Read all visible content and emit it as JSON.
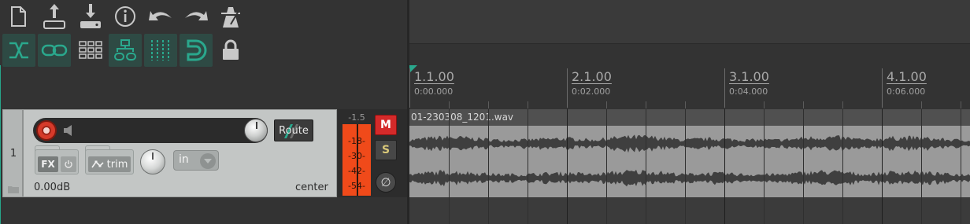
{
  "toolbar": {
    "row1": [
      {
        "icon": "new-project-icon"
      },
      {
        "icon": "save-upload-icon"
      },
      {
        "icon": "open-download-icon"
      },
      {
        "icon": "info-icon"
      },
      {
        "icon": "undo-icon"
      },
      {
        "icon": "redo-icon"
      },
      {
        "icon": "metronome-icon"
      }
    ],
    "row2": [
      {
        "icon": "auto-crossfade-icon",
        "active": true
      },
      {
        "icon": "link-icon",
        "active": true
      },
      {
        "icon": "grid-icon",
        "active": false
      },
      {
        "icon": "item-grouping-icon",
        "active": true
      },
      {
        "icon": "snap-grid-icon",
        "active": true
      },
      {
        "icon": "snap-magnet-icon",
        "active": true
      },
      {
        "icon": "lock-icon",
        "active": false
      }
    ],
    "accent_color": "#2aa88d"
  },
  "ruler": {
    "markers": [
      {
        "bar": "1.1.00",
        "time": "0:00.000"
      },
      {
        "bar": "2.1.00",
        "time": "0:02.000"
      },
      {
        "bar": "3.1.00",
        "time": "0:04.000"
      },
      {
        "bar": "4.1.00",
        "time": "0:06.000"
      }
    ]
  },
  "track": {
    "number": "1",
    "fx_label": "FX",
    "trim_label": "trim",
    "input_label": "in",
    "route_label": "Route",
    "volume_readout": "0.00dB",
    "pan_readout": "center",
    "rec_arm_color": "#d63a2a"
  },
  "meter": {
    "peak": "-1.5",
    "ticks": [
      "-18-",
      "-30-",
      "-42-",
      "-54-"
    ],
    "color": "#f04a1a"
  },
  "buttons": {
    "mute": "M",
    "solo": "S",
    "phase": "∅",
    "mute_color": "#d42a2a"
  },
  "item": {
    "name": "01-230308_1201.wav"
  }
}
